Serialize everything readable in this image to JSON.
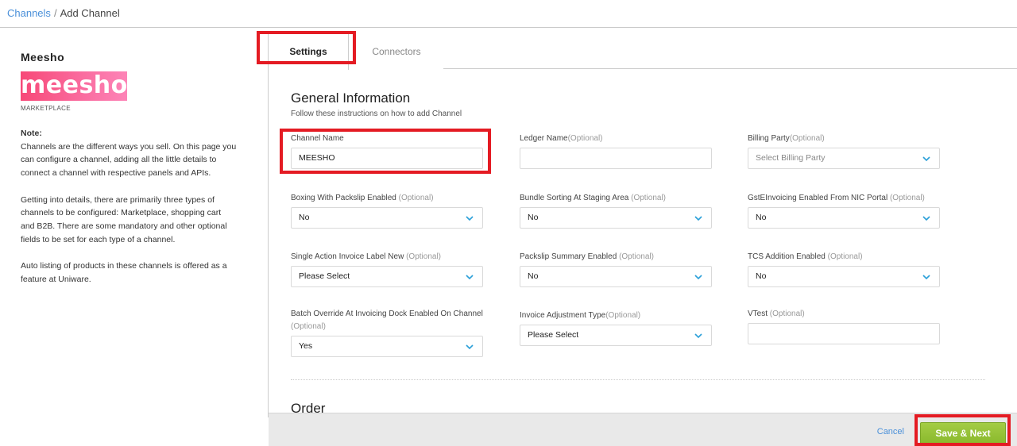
{
  "breadcrumb": {
    "parent": "Channels",
    "separator": "/",
    "current": "Add Channel"
  },
  "sidebar": {
    "channel_title": "Meesho",
    "logo_text": "meesho",
    "channel_type": "MARKETPLACE",
    "note_heading": "Note:",
    "note_paragraphs": [
      "Channels are the different ways you sell. On this page you can configure a channel, adding all the little details to connect a channel with respective panels and APIs.",
      "Getting into details, there are primarily three types of channels to be configured: Marketplace, shopping cart and B2B. There are some mandatory and other optional fields to be set for each type of a channel.",
      "Auto listing of products in these channels is offered as a feature at Uniware."
    ]
  },
  "tabs": [
    {
      "label": "Settings",
      "active": true
    },
    {
      "label": "Connectors",
      "active": false
    }
  ],
  "general": {
    "title": "General Information",
    "subtitle": "Follow these instructions on how to add Channel",
    "fields": {
      "channel_name": {
        "label": "Channel Name",
        "optional": "",
        "type": "text",
        "value": "MEESHO"
      },
      "ledger_name": {
        "label": "Ledger Name",
        "optional": "(Optional)",
        "type": "text",
        "value": ""
      },
      "billing_party": {
        "label": "Billing Party",
        "optional": "(Optional)",
        "type": "select",
        "value": "",
        "placeholder": "Select Billing Party"
      },
      "boxing_packslip": {
        "label": "Boxing With Packslip Enabled",
        "optional": "(Optional)",
        "type": "select",
        "value": "No"
      },
      "bundle_sorting": {
        "label": "Bundle Sorting At Staging Area",
        "optional": "(Optional)",
        "type": "select",
        "value": "No"
      },
      "gst_einvoicing": {
        "label": "GstEInvoicing Enabled From NIC Portal",
        "optional": "(Optional)",
        "type": "select",
        "value": "No"
      },
      "single_action_invoice": {
        "label": "Single Action Invoice Label New",
        "optional": "(Optional)",
        "type": "select",
        "value": "Please Select"
      },
      "packslip_summary": {
        "label": "Packslip Summary Enabled",
        "optional": "(Optional)",
        "type": "select",
        "value": "No"
      },
      "tcs_addition": {
        "label": "TCS Addition Enabled",
        "optional": "(Optional)",
        "type": "select",
        "value": "No"
      },
      "batch_override": {
        "label": "Batch Override At Invoicing Dock Enabled On Channel",
        "optional": "(Optional)",
        "type": "select",
        "value": "Yes"
      },
      "invoice_adjustment": {
        "label": "Invoice Adjustment Type",
        "optional": "(Optional)",
        "type": "select",
        "value": "Please Select"
      },
      "vtest": {
        "label": "VTest",
        "optional": "(Optional)",
        "type": "text",
        "value": ""
      }
    }
  },
  "next_section": {
    "title": "Order"
  },
  "footer": {
    "cancel_label": "Cancel",
    "save_label": "Save & Next"
  },
  "colors": {
    "link": "#4a90d9",
    "primary_button": "#8ab92d",
    "highlight": "#e41b23",
    "logo": "#f74978"
  }
}
